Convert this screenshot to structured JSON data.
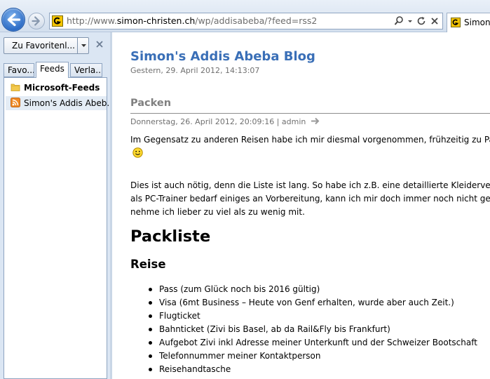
{
  "browser": {
    "url_prefix": "http://www.",
    "url_domain": "simon-christen.ch",
    "url_path": "/wp/addisabeba/?feed=rss2",
    "tab_title": "Simon's",
    "icons": {
      "back": "back-arrow-icon",
      "forward": "forward-arrow-icon",
      "search": "search-icon",
      "refresh": "refresh-icon",
      "stop": "close-icon"
    }
  },
  "favorites": {
    "add_button_label": "Zu Favoritenl...",
    "tabs": [
      {
        "label": "Favo..."
      },
      {
        "label": "Feeds"
      },
      {
        "label": "Verla..."
      }
    ],
    "active_tab": "Feeds",
    "items": [
      {
        "label": "Microsoft-Feeds",
        "kind": "folder"
      },
      {
        "label": "Simon's Addis Abeb...",
        "kind": "feed"
      }
    ]
  },
  "content": {
    "blog_title": "Simon's Addis Abeba Blog",
    "blog_date": "Gestern, 29. April 2012, 14:13:07",
    "post_title": "Packen",
    "post_meta": "Donnerstag, 26. April 2012, 20:09:16 | admin",
    "paragraph1": "Im Gegensatz zu anderen Reisen habe ich mir diesmal vorgenommen, frühzeitig zu Pack",
    "paragraph2_lines": [
      "Dies ist auch nötig, denn die Liste ist lang. So habe ich z.B. eine detaillierte Kleiderverord",
      "als PC-Trainer bedarf einiges an Vorbereitung, kann ich mir doch immer noch nicht gena",
      "nehme ich lieber zu viel als zu wenig mit."
    ],
    "heading1": "Packliste",
    "heading2": "Reise",
    "bullets": [
      "Pass (zum Glück noch bis 2016 gültig)",
      "Visa (6mt Business – Heute von Genf erhalten, wurde aber auch Zeit.)",
      "Flugticket",
      "Bahnticket (Zivi bis Basel, ab da Rail&Fly bis Frankfurt)",
      "Aufgebot Zivi inkl Adresse meiner Unterkunft und der Schweizer Bootschaft",
      "Telefonnummer meiner Kontaktperson",
      "Reisehandtasche"
    ]
  },
  "colors": {
    "blog_title": "#3a6fb7",
    "meta_gray": "#707070",
    "pane_bg": "#dbe6f3"
  }
}
